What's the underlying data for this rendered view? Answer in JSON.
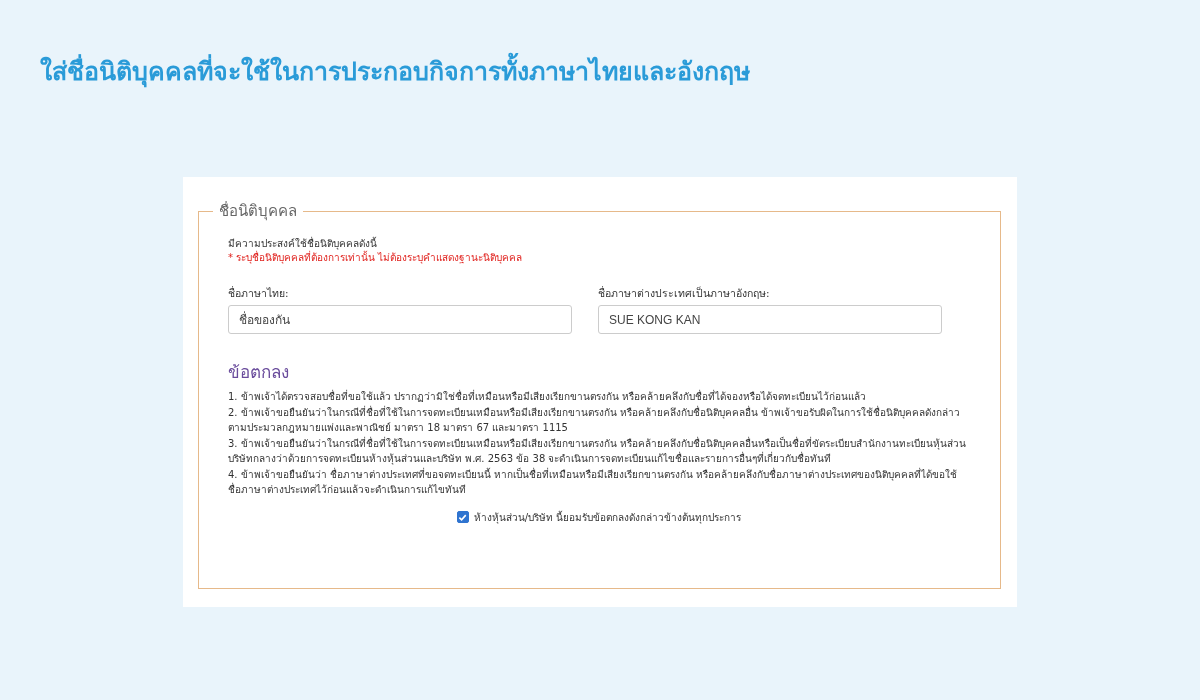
{
  "heading": "ใส่ชื่อนิติบุคคลที่จะใช้ในการประกอบกิจการทั้งภาษาไทยและอังกฤษ",
  "form": {
    "legend": "ชื่อนิติบุคคล",
    "intro": "มีความประสงค์ใช้ชื่อนิติบุคคลดังนี้",
    "note": "* ระบุชื่อนิติบุคคลที่ต้องการเท่านั้น ไม่ต้องระบุคำแสดงฐานะนิติบุคคล",
    "fields": [
      {
        "label": "ชื่อภาษาไทย:",
        "value": "ชื่อของกัน"
      },
      {
        "label": "ชื่อภาษาต่างประเทศเป็นภาษาอังกฤษ:",
        "value": "SUE KONG KAN"
      }
    ],
    "terms_title": "ข้อตกลง",
    "terms": [
      "1. ข้าพเจ้าได้ตรวจสอบชื่อที่ขอใช้แล้ว ปรากฏว่ามิใช่ชื่อที่เหมือนหรือมีเสียงเรียกขานตรงกัน หรือคล้ายคลึงกับชื่อที่ได้จองหรือได้จดทะเบียนไว้ก่อนแล้ว",
      "2. ข้าพเจ้าขอยืนยันว่าในกรณีที่ชื่อที่ใช้ในการจดทะเบียนเหมือนหรือมีเสียงเรียกขานตรงกัน หรือคล้ายคลึงกับชื่อนิติบุคคลอื่น ข้าพเจ้าขอรับผิดในการใช้ชื่อนิติบุคคลดังกล่าวตามประมวลกฎหมายแพ่งและพาณิชย์ มาตรา 18 มาตรา 67 และมาตรา 1115",
      "3. ข้าพเจ้าขอยืนยันว่าในกรณีที่ชื่อที่ใช้ในการจดทะเบียนเหมือนหรือมีเสียงเรียกขานตรงกัน หรือคล้ายคลึงกับชื่อนิติบุคคลอื่นหรือเป็นชื่อที่ขัดระเบียบสำนักงานทะเบียนหุ้นส่วนบริษัทกลางว่าด้วยการจดทะเบียนห้างหุ้นส่วนและบริษัท พ.ศ. 2563 ข้อ 38 จะดำเนินการจดทะเบียนแก้ไขชื่อและรายการอื่นๆที่เกี่ยวกับชื่อทันที",
      "4. ข้าพเจ้าขอยืนยันว่า ชื่อภาษาต่างประเทศที่ขอจดทะเบียนนี้ หากเป็นชื่อที่เหมือนหรือมีเสียงเรียกขานตรงกัน หรือคล้ายคลึงกับชื่อภาษาต่างประเทศของนิติบุคคลที่ได้ขอใช้ชื่อภาษาต่างประเทศไว้ก่อนแล้วจะดำเนินการแก้ไขทันที"
    ],
    "agree": {
      "label": "ห้างหุ้นส่วน/บริษัท นี้ยอมรับข้อตกลงดังกล่าวข้างต้นทุกประการ",
      "checked": true
    }
  }
}
